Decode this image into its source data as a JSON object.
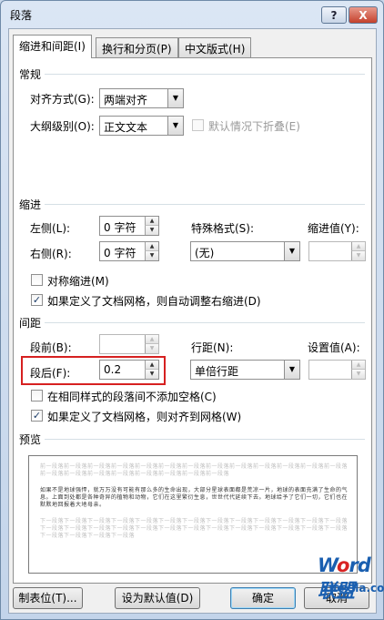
{
  "window": {
    "title": "段落",
    "help_label": "?",
    "close_label": "X"
  },
  "tabs": [
    "缩进和间距(I)",
    "换行和分页(P)",
    "中文版式(H)"
  ],
  "general": {
    "header": "常规",
    "alignment_label": "对齐方式(G):",
    "alignment_value": "两端对齐",
    "outline_label": "大纲级别(O):",
    "outline_value": "正文文本",
    "collapse_label": "默认情况下折叠(E)"
  },
  "indent": {
    "header": "缩进",
    "left_label": "左侧(L):",
    "left_value": "0 字符",
    "right_label": "右侧(R):",
    "right_value": "0 字符",
    "special_label": "特殊格式(S):",
    "special_value": "(无)",
    "indent_by_label": "缩进值(Y):",
    "indent_by_value": "",
    "mirror_label": "对称缩进(M)",
    "auto_adjust_label": "如果定义了文档网格，则自动调整右缩进(D)"
  },
  "spacing": {
    "header": "间距",
    "before_label": "段前(B):",
    "before_value": "",
    "after_label": "段后(F):",
    "after_value": "0.2",
    "line_label": "行距(N):",
    "line_value": "单倍行距",
    "at_label": "设置值(A):",
    "at_value": "",
    "no_space_label": "在相同样式的段落间不添加空格(C)",
    "snap_grid_label": "如果定义了文档网格，则对齐到网格(W)"
  },
  "preview": {
    "header": "预览",
    "prev_text": "前一段落前一段落前一段落前一段落前一段落前一段落前一段落前一段落前一段落前一段落前一段落前一段落前一段落前一段落前一段落前一段落前一段落前一段落前一段落前一段落前一段落",
    "sample_text": "如果不是地球强悍，就万万没有可能有那么多的生命出现，大部分星球表面都是荒凉一片，地球的表面充满了生命的气息。上面到处都是各种奇异的植物和动物，它们在这里繁衍生息，世世代代延续下去。地球给予了它们一切，它们也在默默地回报着大地母亲。",
    "next_text": "下一段落下一段落下一段落下一段落下一段落下一段落下一段落下一段落下一段落下一段落下一段落下一段落下一段落下一段落下一段落下一段落下一段落下一段落下一段落下一段落下一段落下一段落下一段落下一段落下一段落下一段落下一段落下一段落下一段落下一段落"
  },
  "buttons": {
    "tabs": "制表位(T)...",
    "set_default": "设为默认值(D)",
    "ok": "确定",
    "cancel": "取消"
  },
  "watermark": {
    "logo_w": "W",
    "logo_o": "o",
    "logo_rd": "rd",
    "logo_cn": "联盟",
    "url": "xuexila.com"
  }
}
